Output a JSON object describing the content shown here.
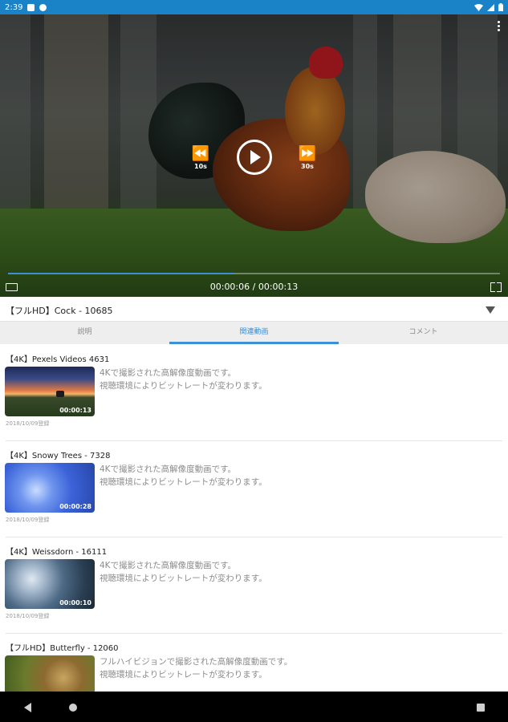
{
  "status_bar": {
    "time": "2:39"
  },
  "player": {
    "seek_back_label": "10s",
    "seek_forward_label": "30s",
    "current_time": "00:00:06",
    "separator": " / ",
    "total_time": "00:00:13",
    "progress": 0.46
  },
  "video_title": "【フルHD】Cock - 10685",
  "tabs": [
    {
      "label": "説明"
    },
    {
      "label": "関連動画"
    },
    {
      "label": "コメント"
    }
  ],
  "active_tab": 1,
  "related_videos": [
    {
      "title": "【4K】Pexels Videos 4631",
      "duration": "00:00:13",
      "desc_line1": "4Kで撮影された高解像度動画です。",
      "desc_line2": "視聴環境によりビットレートが変わります。",
      "date": "2018/10/09登録"
    },
    {
      "title": "【4K】Snowy Trees - 7328",
      "duration": "00:00:28",
      "desc_line1": "4Kで撮影された高解像度動画です。",
      "desc_line2": "視聴環境によりビットレートが変わります。",
      "date": "2018/10/09登録"
    },
    {
      "title": "【4K】Weissdorn - 16111",
      "duration": "00:00:10",
      "desc_line1": "4Kで撮影された高解像度動画です。",
      "desc_line2": "視聴環境によりビットレートが変わります。",
      "date": "2018/10/09登録"
    },
    {
      "title": "【フルHD】Butterfly - 12060",
      "duration": "",
      "desc_line1": "フルハイビジョンで撮影された高解像度動画です。",
      "desc_line2": "視聴環境によりビットレートが変わります。",
      "date": ""
    }
  ]
}
